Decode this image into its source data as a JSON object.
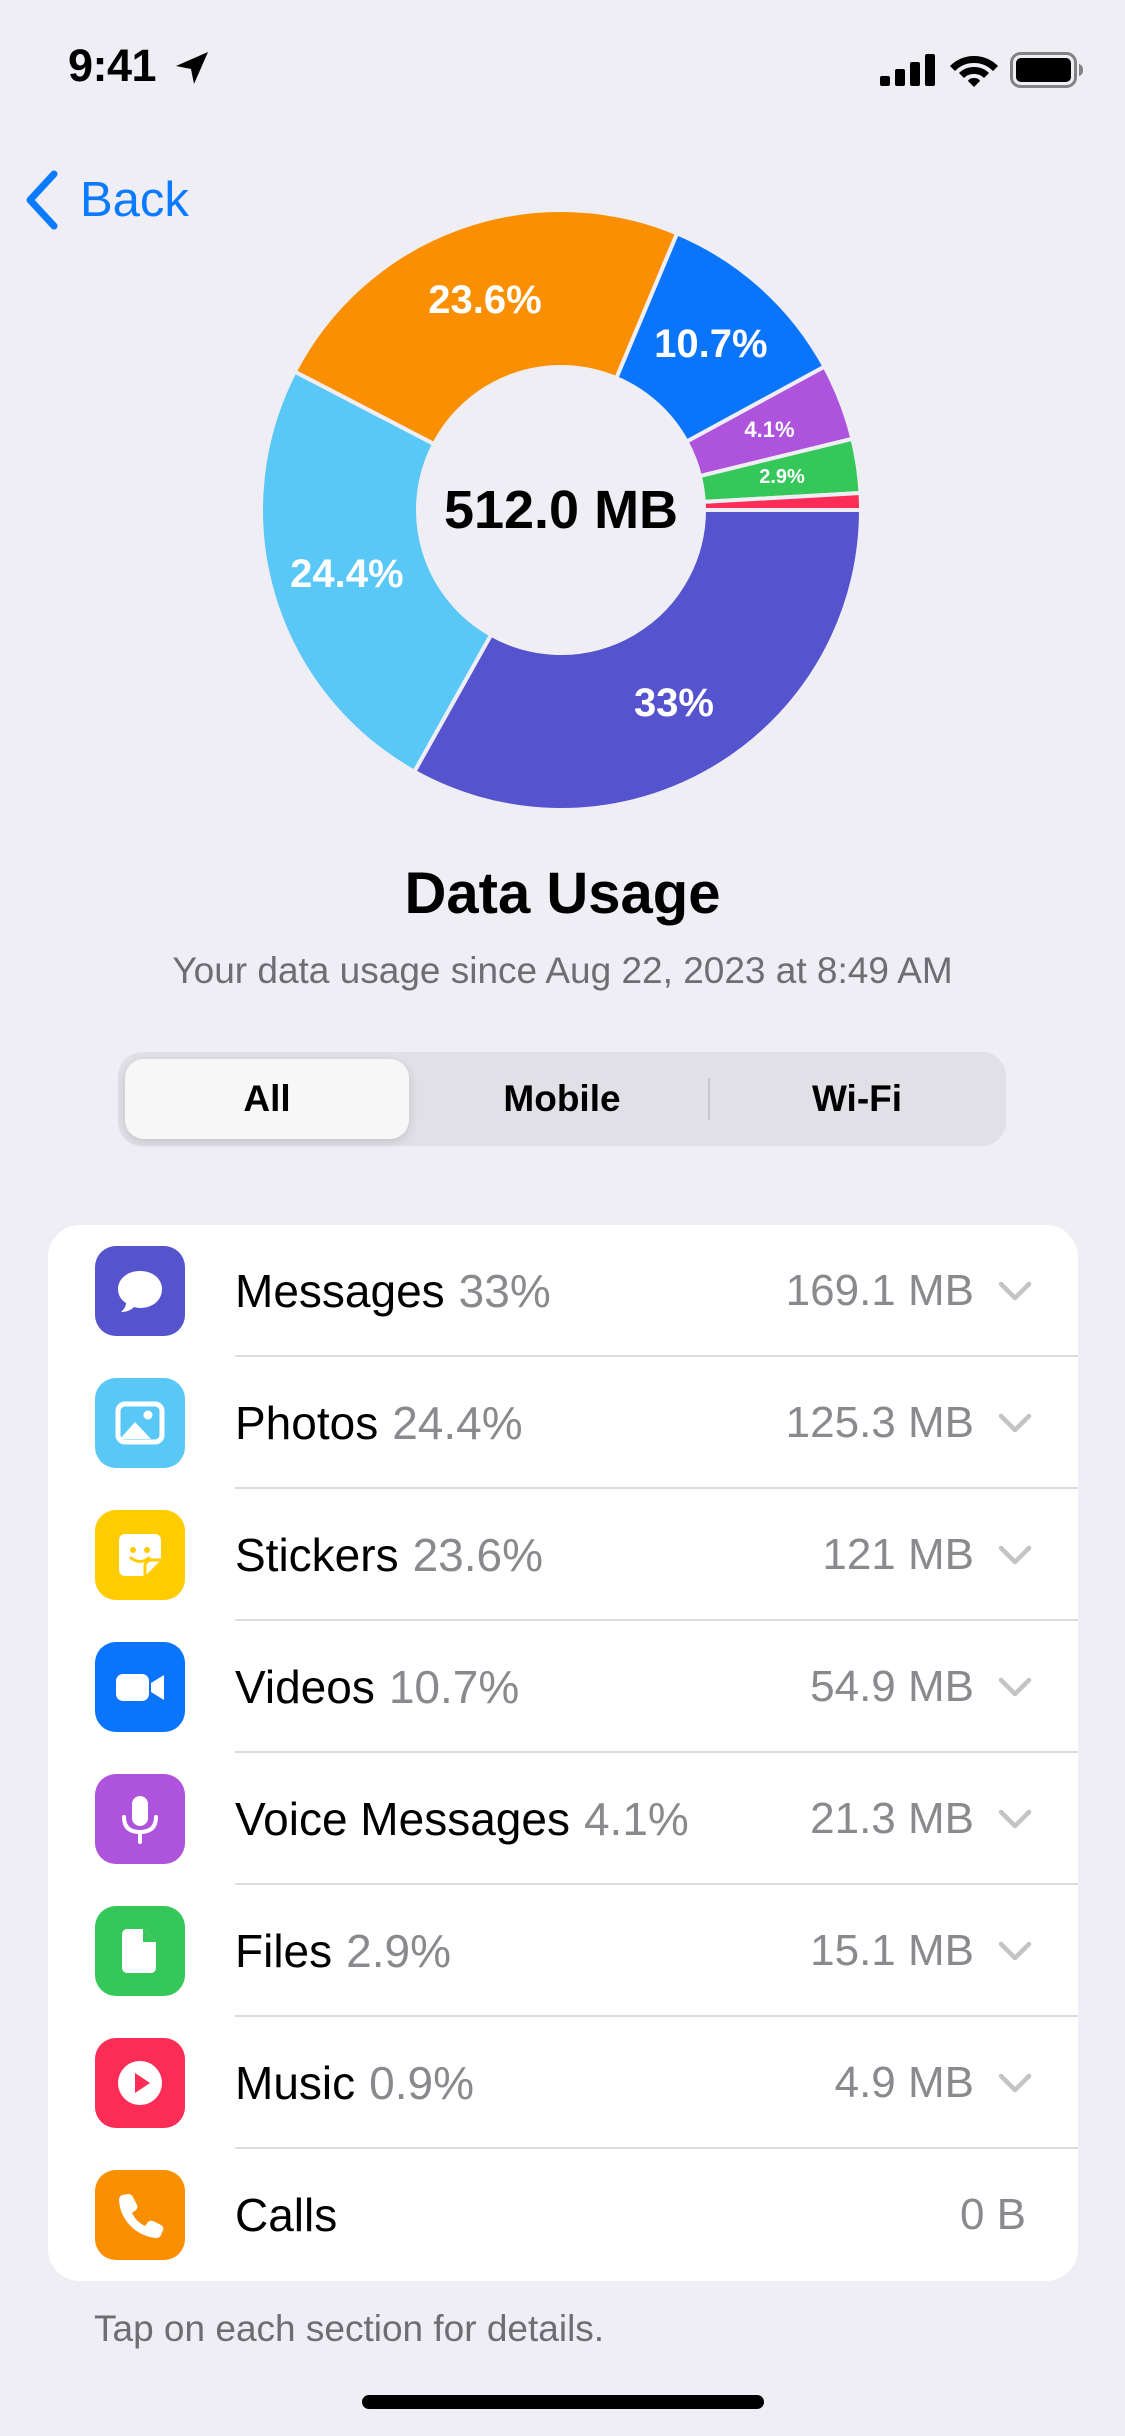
{
  "status_bar": {
    "time": "9:41"
  },
  "nav": {
    "back_label": "Back"
  },
  "chart_data": {
    "type": "pie",
    "center_label": "512.0 MB",
    "slices": [
      {
        "label": "Messages",
        "value": 33,
        "display": "33%",
        "color": "#5553CE"
      },
      {
        "label": "Photos",
        "value": 24.4,
        "display": "24.4%",
        "color": "#5AC8F6"
      },
      {
        "label": "Stickers",
        "value": 23.6,
        "display": "23.6%",
        "color": "#FA8F01"
      },
      {
        "label": "Videos",
        "value": 10.7,
        "display": "10.7%",
        "color": "#0A74FA"
      },
      {
        "label": "Voice Messages",
        "value": 4.1,
        "display": "4.1%",
        "color": "#AE53DC"
      },
      {
        "label": "Files",
        "value": 2.9,
        "display": "2.9%",
        "color": "#35C759"
      },
      {
        "label": "Music",
        "value": 0.9,
        "display": "",
        "color": "#FB2C56"
      }
    ]
  },
  "header": {
    "title": "Data Usage",
    "subtitle": "Your data usage since Aug 22, 2023 at 8:49 AM"
  },
  "segments": [
    {
      "label": "All",
      "active": true
    },
    {
      "label": "Mobile",
      "active": false
    },
    {
      "label": "Wi-Fi",
      "active": false
    }
  ],
  "list": [
    {
      "name": "Messages",
      "percent": "33%",
      "size": "169.1 MB",
      "icon": "message-bubble-icon",
      "color": "#5553CE",
      "chevron": true
    },
    {
      "name": "Photos",
      "percent": "24.4%",
      "size": "125.3 MB",
      "icon": "photo-icon",
      "color": "#5AC8F6",
      "chevron": true
    },
    {
      "name": "Stickers",
      "percent": "23.6%",
      "size": "121 MB",
      "icon": "sticker-icon",
      "color": "#FFCC00",
      "chevron": true
    },
    {
      "name": "Videos",
      "percent": "10.7%",
      "size": "54.9 MB",
      "icon": "video-camera-icon",
      "color": "#0A74FA",
      "chevron": true
    },
    {
      "name": "Voice Messages",
      "percent": "4.1%",
      "size": "21.3 MB",
      "icon": "microphone-icon",
      "color": "#AE53DC",
      "chevron": true
    },
    {
      "name": "Files",
      "percent": "2.9%",
      "size": "15.1 MB",
      "icon": "document-icon",
      "color": "#35C759",
      "chevron": true
    },
    {
      "name": "Music",
      "percent": "0.9%",
      "size": "4.9 MB",
      "icon": "play-icon",
      "color": "#FB2C56",
      "chevron": true
    },
    {
      "name": "Calls",
      "percent": "",
      "size": "0 B",
      "icon": "phone-icon",
      "color": "#FA8F01",
      "chevron": false
    }
  ],
  "footer": {
    "note": "Tap on each section for details."
  },
  "colors": {
    "accent": "#0A7AFF",
    "background": "#EFEEF4",
    "secondary_text": "#8A8A8E"
  }
}
